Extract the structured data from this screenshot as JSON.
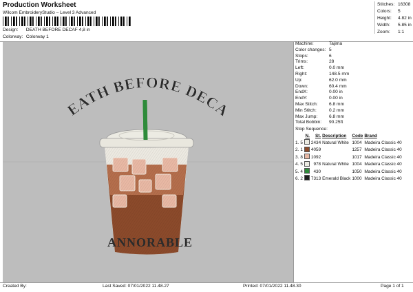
{
  "header": {
    "title": "Production Worksheet",
    "subtitle": "Wilcom EmbroideryStudio – Level 3 Advanced",
    "design_label": "Design:",
    "design_value": "DEATH BEFORE DECAF 4,8 in",
    "colorway_label": "Colorway:",
    "colorway_value": "Colorway 1"
  },
  "top_stats": [
    {
      "label": "Stitches:",
      "value": "16308"
    },
    {
      "label": "Colors:",
      "value": "5"
    },
    {
      "label": "Height:",
      "value": "4.82 in"
    },
    {
      "label": "Width:",
      "value": "5.85 in"
    },
    {
      "label": "Zoom:",
      "value": "1:1"
    }
  ],
  "design": {
    "top_text": "DEATH BEFORE DECAF",
    "bottom_text": "ANNORABLE"
  },
  "machine_info": [
    {
      "label": "Machine:",
      "value": "Tajima"
    },
    {
      "label": "Color changes:",
      "value": "5"
    },
    {
      "label": "Stops:",
      "value": "6"
    },
    {
      "label": "Trims:",
      "value": "28"
    },
    {
      "label": "Left:",
      "value": "0.0 mm"
    },
    {
      "label": "Right:",
      "value": "148.5 mm"
    },
    {
      "label": "Up:",
      "value": "62.0 mm"
    },
    {
      "label": "Down:",
      "value": "60.4 mm"
    },
    {
      "label": "EndX:",
      "value": "0.00 in"
    },
    {
      "label": "EndY:",
      "value": "0.00 in"
    },
    {
      "label": "Max Stitch:",
      "value": "6.8 mm"
    },
    {
      "label": "Min Stitch:",
      "value": "0.2 mm"
    },
    {
      "label": "Max Jump:",
      "value": "6.8 mm"
    },
    {
      "label": "Total Bobbin:",
      "value": "90.25ft"
    }
  ],
  "stop_sequence": {
    "title": "Stop Sequence:",
    "headers": [
      "N.",
      "St.",
      "Description",
      "Code",
      "Brand"
    ],
    "rows": [
      {
        "idx": "1.",
        "n": "5",
        "color": "#ecebe3",
        "st": "2434",
        "desc": "Natural White",
        "code": "1004",
        "brand": "Madeira Classic 40"
      },
      {
        "idx": "2.",
        "n": "1",
        "color": "#8b4a2b",
        "st": "4059",
        "desc": "",
        "code": "1257",
        "brand": "Madeira Classic 40"
      },
      {
        "idx": "3.",
        "n": "8",
        "color": "#e8b8a4",
        "st": "1092",
        "desc": "",
        "code": "1017",
        "brand": "Madeira Classic 40"
      },
      {
        "idx": "4.",
        "n": "5",
        "color": "#ecebe3",
        "st": "978",
        "desc": "Natural White",
        "code": "1004",
        "brand": "Madeira Classic 40"
      },
      {
        "idx": "5.",
        "n": "4",
        "color": "#2e8b3a",
        "st": "430",
        "desc": "",
        "code": "1050",
        "brand": "Madeira Classic 40"
      },
      {
        "idx": "6.",
        "n": "2",
        "color": "#1d1d1d",
        "st": "7313",
        "desc": "Emerald Black",
        "code": "1000",
        "brand": "Madeira Classic 40"
      }
    ]
  },
  "footer": {
    "created_by": "Created By:",
    "last_saved": "Last Saved: 07/01/2022 11.48.27",
    "printed": "Printed: 07/01/2022 11.48.30",
    "page": "Page 1 of 1"
  }
}
